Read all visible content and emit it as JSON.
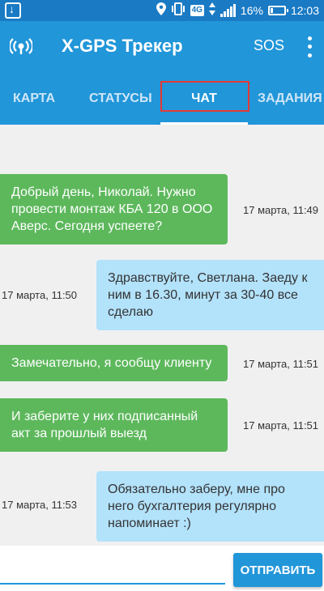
{
  "status_bar": {
    "network": "4G",
    "battery": "16%",
    "battery_level": 0.16,
    "time": "12:03",
    "icons": [
      "download-icon",
      "location-icon",
      "vibrate-icon",
      "network-4g-icon",
      "signal-icon",
      "battery-icon"
    ]
  },
  "toolbar": {
    "title": "X-GPS Трекер",
    "sos_label": "SOS",
    "app_icon": "gps-signal-icon",
    "menu_icon": "more-vert-icon"
  },
  "tabs": [
    {
      "label": "КАРТА",
      "active": false
    },
    {
      "label": "СТАТУСЫ",
      "active": false
    },
    {
      "label": "ЧАТ",
      "active": true
    },
    {
      "label": "ЗАДАНИЯ",
      "active": false
    }
  ],
  "messages": [
    {
      "direction": "in",
      "text": "Добрый день, Николай. Нужно провести монтаж КБА 120 в ООО Аверс. Сегодня успеете?",
      "time": "17 марта, 11:49"
    },
    {
      "direction": "out",
      "text": "Здравствуйте, Светлана. Заеду к ним в 16.30, минут за 30-40 все сделаю",
      "time": "17 марта, 11:50"
    },
    {
      "direction": "in",
      "text": "Замечательно, я сообщу клиенту",
      "time": "17 марта, 11:51"
    },
    {
      "direction": "in",
      "text": "И заберите у них подписанный акт за прошлый выезд",
      "time": "17 марта, 11:51"
    },
    {
      "direction": "out",
      "text": "Обязательно заберу, мне про него бухгалтерия регулярно напоминает :)",
      "time": "17 марта, 11:53"
    }
  ],
  "composer": {
    "input_value": "",
    "send_label": "ОТПРАВИТЬ"
  },
  "colors": {
    "primary": "#2196d9",
    "status_bar": "#1a7ac4",
    "incoming_bubble": "#5db85c",
    "outgoing_bubble": "#b3e2fb",
    "highlight": "#e53935"
  }
}
